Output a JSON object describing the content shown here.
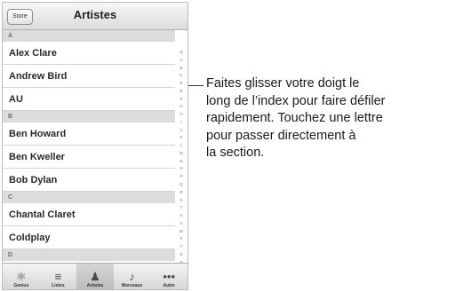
{
  "navbar": {
    "store_label": "Store",
    "title": "Artistes"
  },
  "list": [
    {
      "type": "section",
      "label": "A"
    },
    {
      "type": "row",
      "label": "Alex Clare"
    },
    {
      "type": "row",
      "label": "Andrew Bird"
    },
    {
      "type": "row",
      "label": "AU"
    },
    {
      "type": "section",
      "label": "B"
    },
    {
      "type": "row",
      "label": "Ben Howard"
    },
    {
      "type": "row",
      "label": "Ben Kweller"
    },
    {
      "type": "row",
      "label": "Bob Dylan"
    },
    {
      "type": "section",
      "label": "C"
    },
    {
      "type": "row",
      "label": "Chantal Claret"
    },
    {
      "type": "row",
      "label": "Coldplay"
    },
    {
      "type": "section",
      "label": "D"
    }
  ],
  "index": [
    "Q",
    "A",
    "B",
    "C",
    "D",
    "E",
    "F",
    "G",
    "H",
    "I",
    "J",
    "K",
    "L",
    "M",
    "N",
    "O",
    "P",
    "Q",
    "R",
    "S",
    "T",
    "U",
    "V",
    "W",
    "X",
    "Y",
    "Z",
    "#"
  ],
  "tabbar": [
    {
      "label": "Genius",
      "icon": "genius-icon",
      "glyph": "⚛",
      "active": false
    },
    {
      "label": "Listes",
      "icon": "playlist-icon",
      "glyph": "≡",
      "active": false
    },
    {
      "label": "Artistes",
      "icon": "artist-icon",
      "glyph": "♟",
      "active": true
    },
    {
      "label": "Morceaux",
      "icon": "music-note-icon",
      "glyph": "♪",
      "active": false
    },
    {
      "label": "Autre",
      "icon": "more-icon",
      "glyph": "•••",
      "active": false
    }
  ],
  "callout": {
    "lines": [
      "Faites glisser votre doigt le",
      "long de l’index pour faire défiler",
      "rapidement. Touchez une lettre",
      "pour passer directement à",
      "la section."
    ]
  }
}
